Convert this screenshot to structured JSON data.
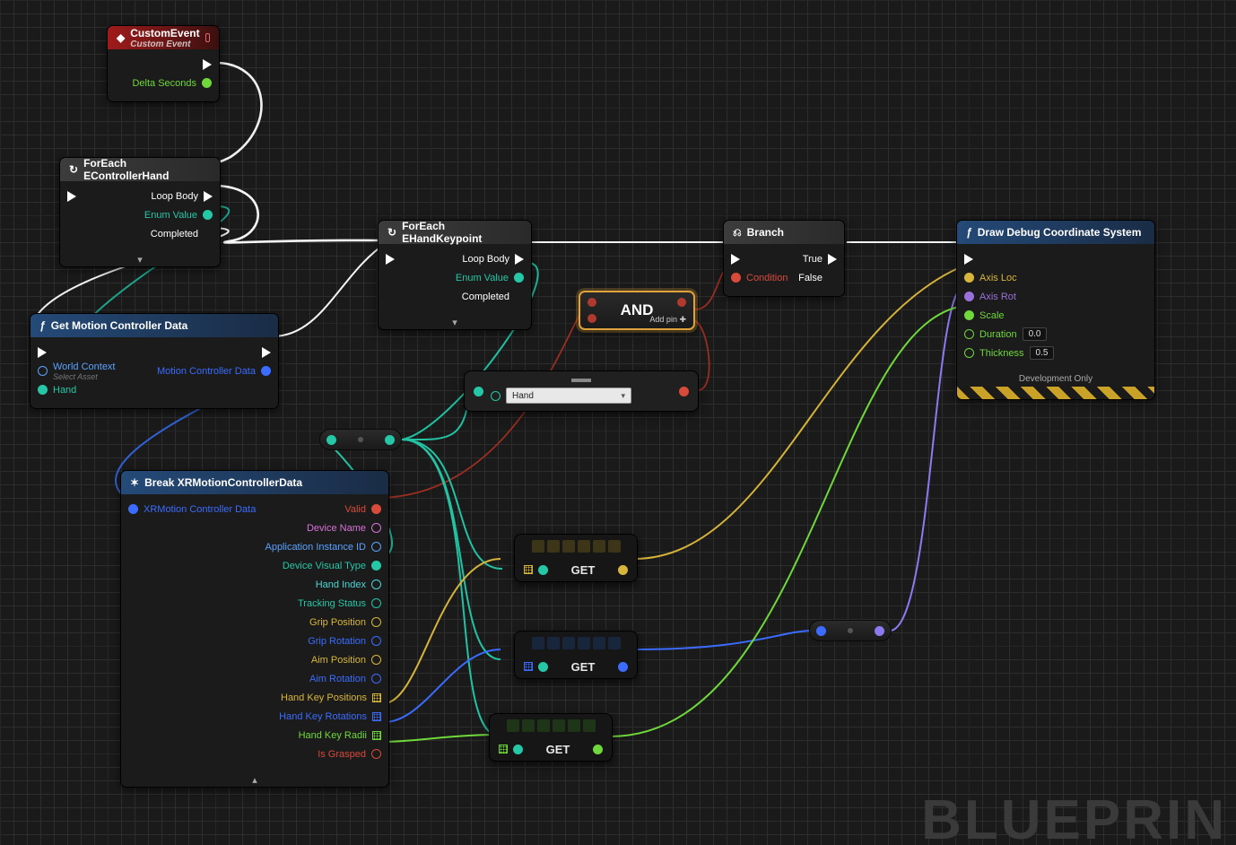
{
  "watermark": "BLUEPRIN",
  "nodes": {
    "custom_event": {
      "title": "CustomEvent",
      "subtitle": "Custom Event",
      "out_pin": "Delta Seconds"
    },
    "foreach_hand": {
      "title": "ForEach EControllerHand",
      "p1": "Loop Body",
      "p2": "Enum Value",
      "p3": "Completed"
    },
    "get_motion": {
      "title": "Get Motion Controller Data",
      "wc": "World Context",
      "wc_hint": "Select Asset",
      "hand": "Hand",
      "out": "Motion Controller Data"
    },
    "foreach_key": {
      "title": "ForEach EHandKeypoint",
      "p1": "Loop Body",
      "p2": "Enum Value",
      "p3": "Completed"
    },
    "branch": {
      "title": "Branch",
      "cond": "Condition",
      "t": "True",
      "f": "False"
    },
    "and": {
      "label": "AND",
      "add": "Add pin"
    },
    "dropnode": {
      "selected": "Hand"
    },
    "break": {
      "title": "Break XRMotionControllerData",
      "input": "XRMotion Controller Data",
      "outputs": [
        "Valid",
        "Device Name",
        "Application Instance ID",
        "Device Visual Type",
        "Hand Index",
        "Tracking Status",
        "Grip Position",
        "Grip Rotation",
        "Aim Position",
        "Aim Rotation",
        "Hand Key Positions",
        "Hand Key Rotations",
        "Hand Key Radii",
        "Is Grasped"
      ]
    },
    "get_label": "GET",
    "draw": {
      "title": "Draw Debug Coordinate System",
      "axisloc": "Axis Loc",
      "axisrot": "Axis Rot",
      "scale": "Scale",
      "dur": "Duration",
      "dur_val": "0.0",
      "thk": "Thickness",
      "thk_val": "0.5",
      "dev": "Development Only"
    }
  }
}
